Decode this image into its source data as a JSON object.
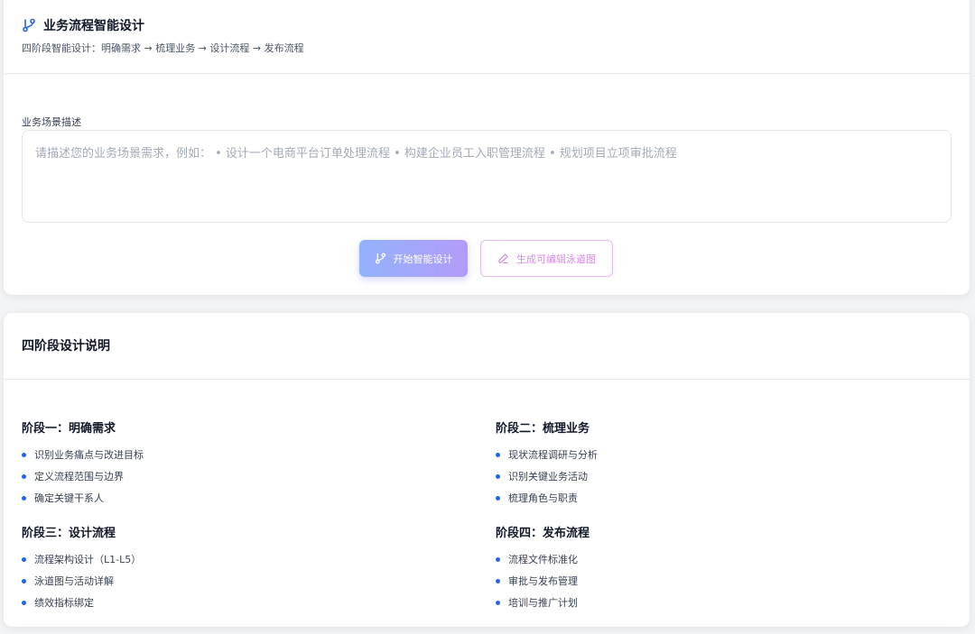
{
  "header": {
    "title": "业务流程智能设计",
    "subtitle": "四阶段智能设计：明确需求 → 梳理业务 → 设计流程 → 发布流程",
    "icon": "git-branch-icon"
  },
  "form": {
    "label": "业务场景描述",
    "placeholder": "请描述您的业务场景需求，例如： • 设计一个电商平台订单处理流程 • 构建企业员工入职管理流程 • 规划项目立项审批流程",
    "value": ""
  },
  "actions": {
    "start_label": "开始智能设计",
    "swimlane_label": "生成可编辑泳道图"
  },
  "stages_section": {
    "title": "四阶段设计说明",
    "stages": [
      {
        "title": "阶段一：明确需求",
        "items": [
          "识别业务痛点与改进目标",
          "定义流程范围与边界",
          "确定关键干系人"
        ]
      },
      {
        "title": "阶段二：梳理业务",
        "items": [
          "现状流程调研与分析",
          "识别关键业务活动",
          "梳理角色与职责"
        ]
      },
      {
        "title": "阶段三：设计流程",
        "items": [
          "流程架构设计（L1-L5）",
          "泳道图与活动详解",
          "绩效指标绑定"
        ]
      },
      {
        "title": "阶段四：发布流程",
        "items": [
          "流程文件标准化",
          "审批与发布管理",
          "培训与推广计划"
        ]
      }
    ]
  },
  "colors": {
    "accent": "#2563eb",
    "primary_gradient_start": "#93b2fb",
    "primary_gradient_end": "#b39cf9",
    "secondary_border": "#e7b8f3",
    "secondary_text": "#d68be6"
  }
}
